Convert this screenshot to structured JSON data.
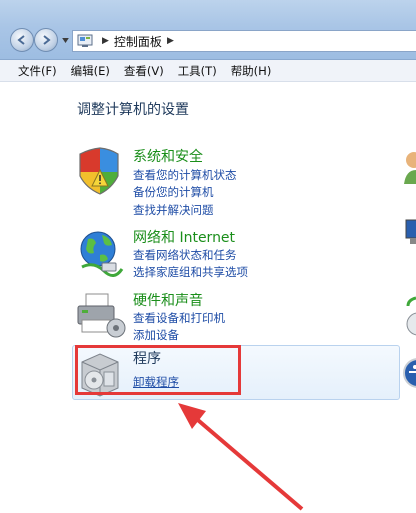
{
  "address_bar": {
    "path": "控制面板"
  },
  "menu": {
    "items": [
      "文件(F)",
      "编辑(E)",
      "查看(V)",
      "工具(T)",
      "帮助(H)"
    ]
  },
  "content": {
    "heading": "调整计算机的设置",
    "categories": [
      {
        "title": "系统和安全",
        "links": [
          "查看您的计算机状态",
          "备份您的计算机",
          "查找并解决问题"
        ]
      },
      {
        "title": "网络和 Internet",
        "links": [
          "查看网络状态和任务",
          "选择家庭组和共享选项"
        ]
      },
      {
        "title": "硬件和声音",
        "links": [
          "查看设备和打印机",
          "添加设备"
        ]
      },
      {
        "title": "程序",
        "links": [
          "卸载程序"
        ]
      }
    ]
  },
  "colors": {
    "category_title": "#1a8e1a",
    "link": "#1f4da6",
    "annotation": "#e53939"
  }
}
